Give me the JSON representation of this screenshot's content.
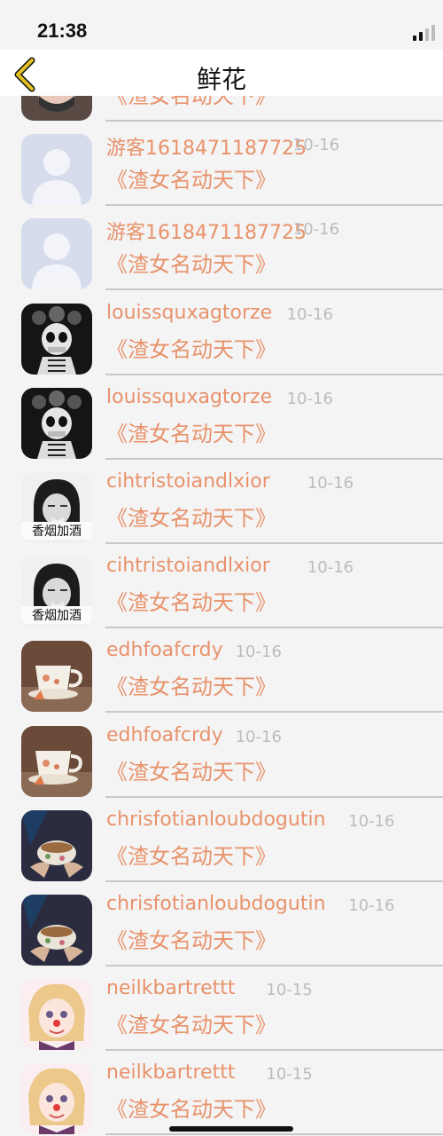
{
  "status_bar": {
    "time": "21:38"
  },
  "nav": {
    "title": "鲜花"
  },
  "colors": {
    "accent": "#e8926b",
    "date": "#bcbcbc",
    "back": "#e3c227"
  },
  "rows": [
    {
      "name": "",
      "date": "",
      "gift": "《渣女名动天下》",
      "avatar": "girl-mask-avatar"
    },
    {
      "name": "游客1618471187725",
      "date": "10-16",
      "gift": "《渣女名动天下》",
      "avatar": "default-user-avatar"
    },
    {
      "name": "游客1618471187725",
      "date": "10-16",
      "gift": "《渣女名动天下》",
      "avatar": "default-user-avatar"
    },
    {
      "name": "louissquxagtorze",
      "date": "10-16",
      "gift": "《渣女名动天下》",
      "avatar": "skull-avatar"
    },
    {
      "name": "louissquxagtorze",
      "date": "10-16",
      "gift": "《渣女名动天下》",
      "avatar": "skull-avatar"
    },
    {
      "name": "cihtristoiandlxior",
      "date": "10-16",
      "gift": "《渣女名动天下》",
      "avatar": "smoke-avatar",
      "avatar_text": "香烟加酒"
    },
    {
      "name": "cihtristoiandlxior",
      "date": "10-16",
      "gift": "《渣女名动天下》",
      "avatar": "smoke-avatar",
      "avatar_text": "香烟加酒"
    },
    {
      "name": "edhfoafcrdy",
      "date": "10-16",
      "gift": "《渣女名动天下》",
      "avatar": "teacup-avatar"
    },
    {
      "name": "edhfoafcrdy",
      "date": "10-16",
      "gift": "《渣女名动天下》",
      "avatar": "teacup-avatar"
    },
    {
      "name": "chrisfotianloubdogutin",
      "date": "10-16",
      "gift": "《渣女名动天下》",
      "avatar": "teacup-hands-avatar"
    },
    {
      "name": "chrisfotianloubdogutin",
      "date": "10-16",
      "gift": "《渣女名动天下》",
      "avatar": "teacup-hands-avatar"
    },
    {
      "name": "neilkbartrettt",
      "date": "10-15",
      "gift": "《渣女名动天下》",
      "avatar": "clown-girl-avatar"
    },
    {
      "name": "neilkbartrettt",
      "date": "10-15",
      "gift": "《渣女名动天下》",
      "avatar": "clown-girl-avatar"
    }
  ]
}
